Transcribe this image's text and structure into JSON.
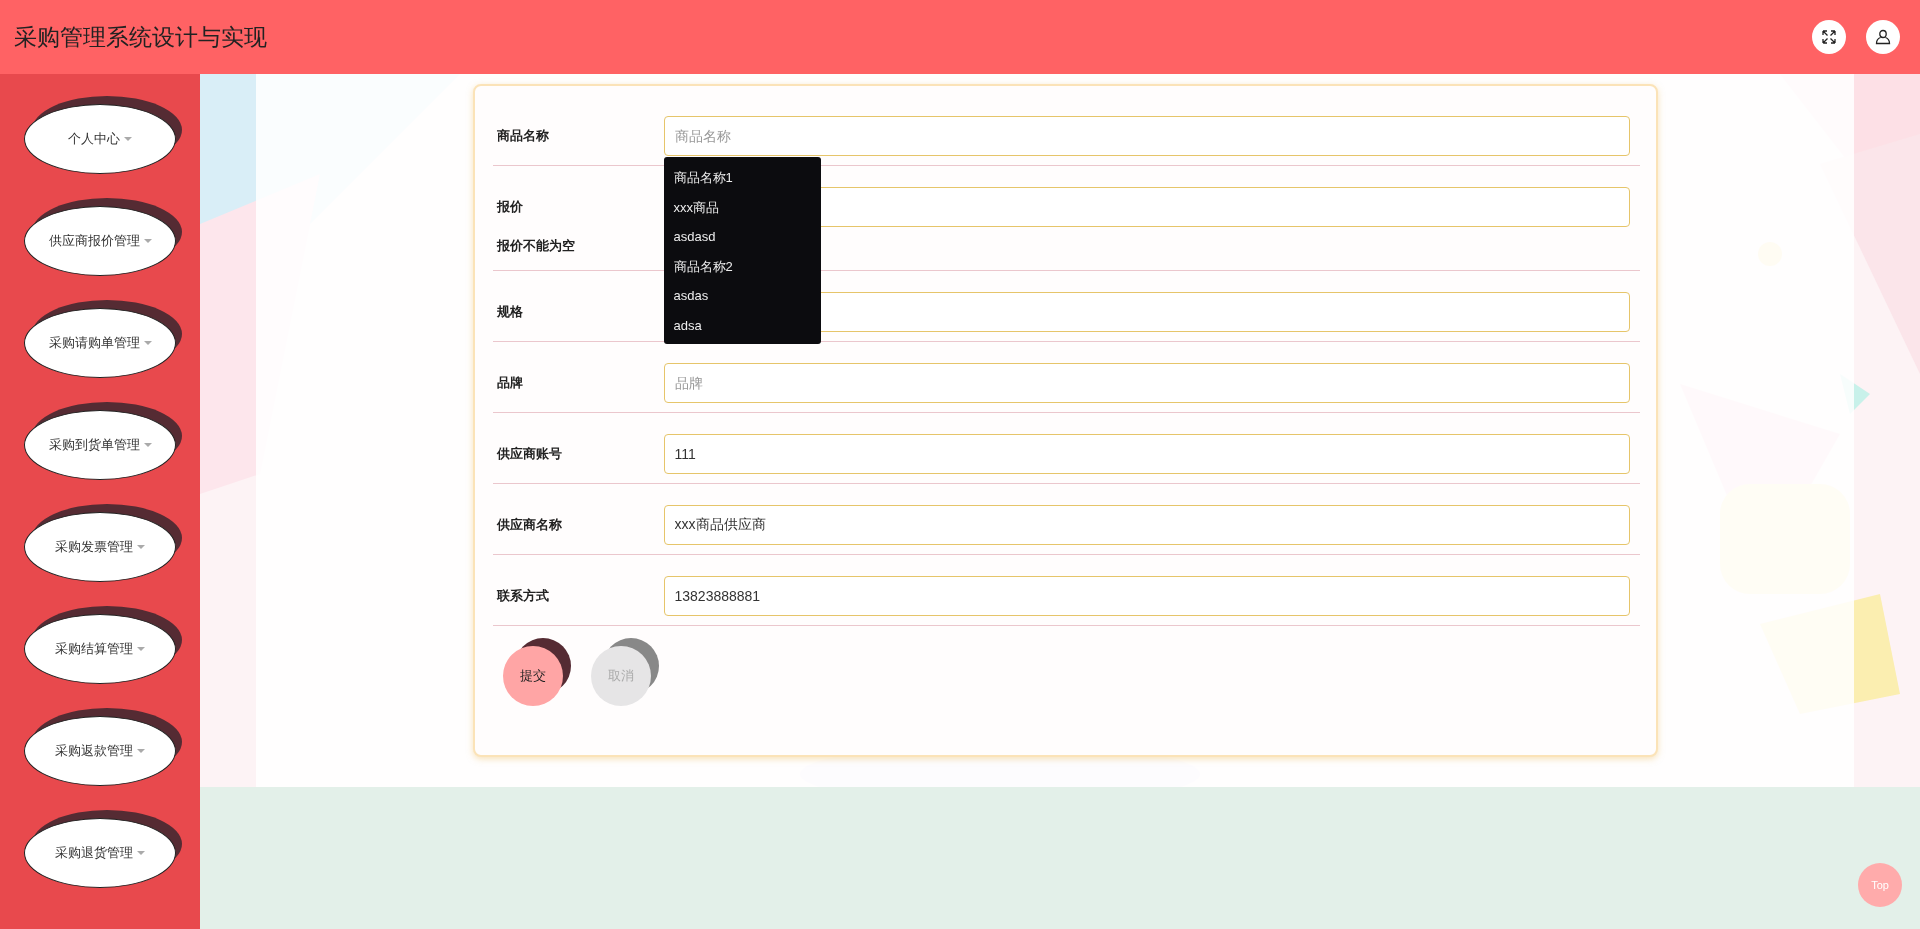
{
  "header": {
    "title": "采购管理系统设计与实现"
  },
  "sidebar": {
    "items": [
      {
        "label": "个人中心"
      },
      {
        "label": "供应商报价管理"
      },
      {
        "label": "采购请购单管理"
      },
      {
        "label": "采购到货单管理"
      },
      {
        "label": "采购发票管理"
      },
      {
        "label": "采购结算管理"
      },
      {
        "label": "采购返款管理"
      },
      {
        "label": "采购退货管理"
      }
    ]
  },
  "form": {
    "fields": [
      {
        "label": "商品名称",
        "placeholder": "商品名称"
      },
      {
        "label": "报价",
        "error": "报价不能为空"
      },
      {
        "label": "规格"
      },
      {
        "label": "品牌",
        "placeholder": "品牌"
      },
      {
        "label": "供应商账号",
        "value": "111"
      },
      {
        "label": "供应商名称",
        "value": "xxx商品供应商"
      },
      {
        "label": "联系方式",
        "value": "13823888881"
      }
    ],
    "suggestions": [
      "商品名称1",
      "xxx商品",
      "asdasd",
      "商品名称2",
      "asdas",
      "adsa"
    ],
    "buttons": [
      {
        "label": "提交",
        "kind": "primary"
      },
      {
        "label": "取消",
        "kind": "secondary"
      }
    ]
  },
  "back_to_top": {
    "label": "Top"
  }
}
